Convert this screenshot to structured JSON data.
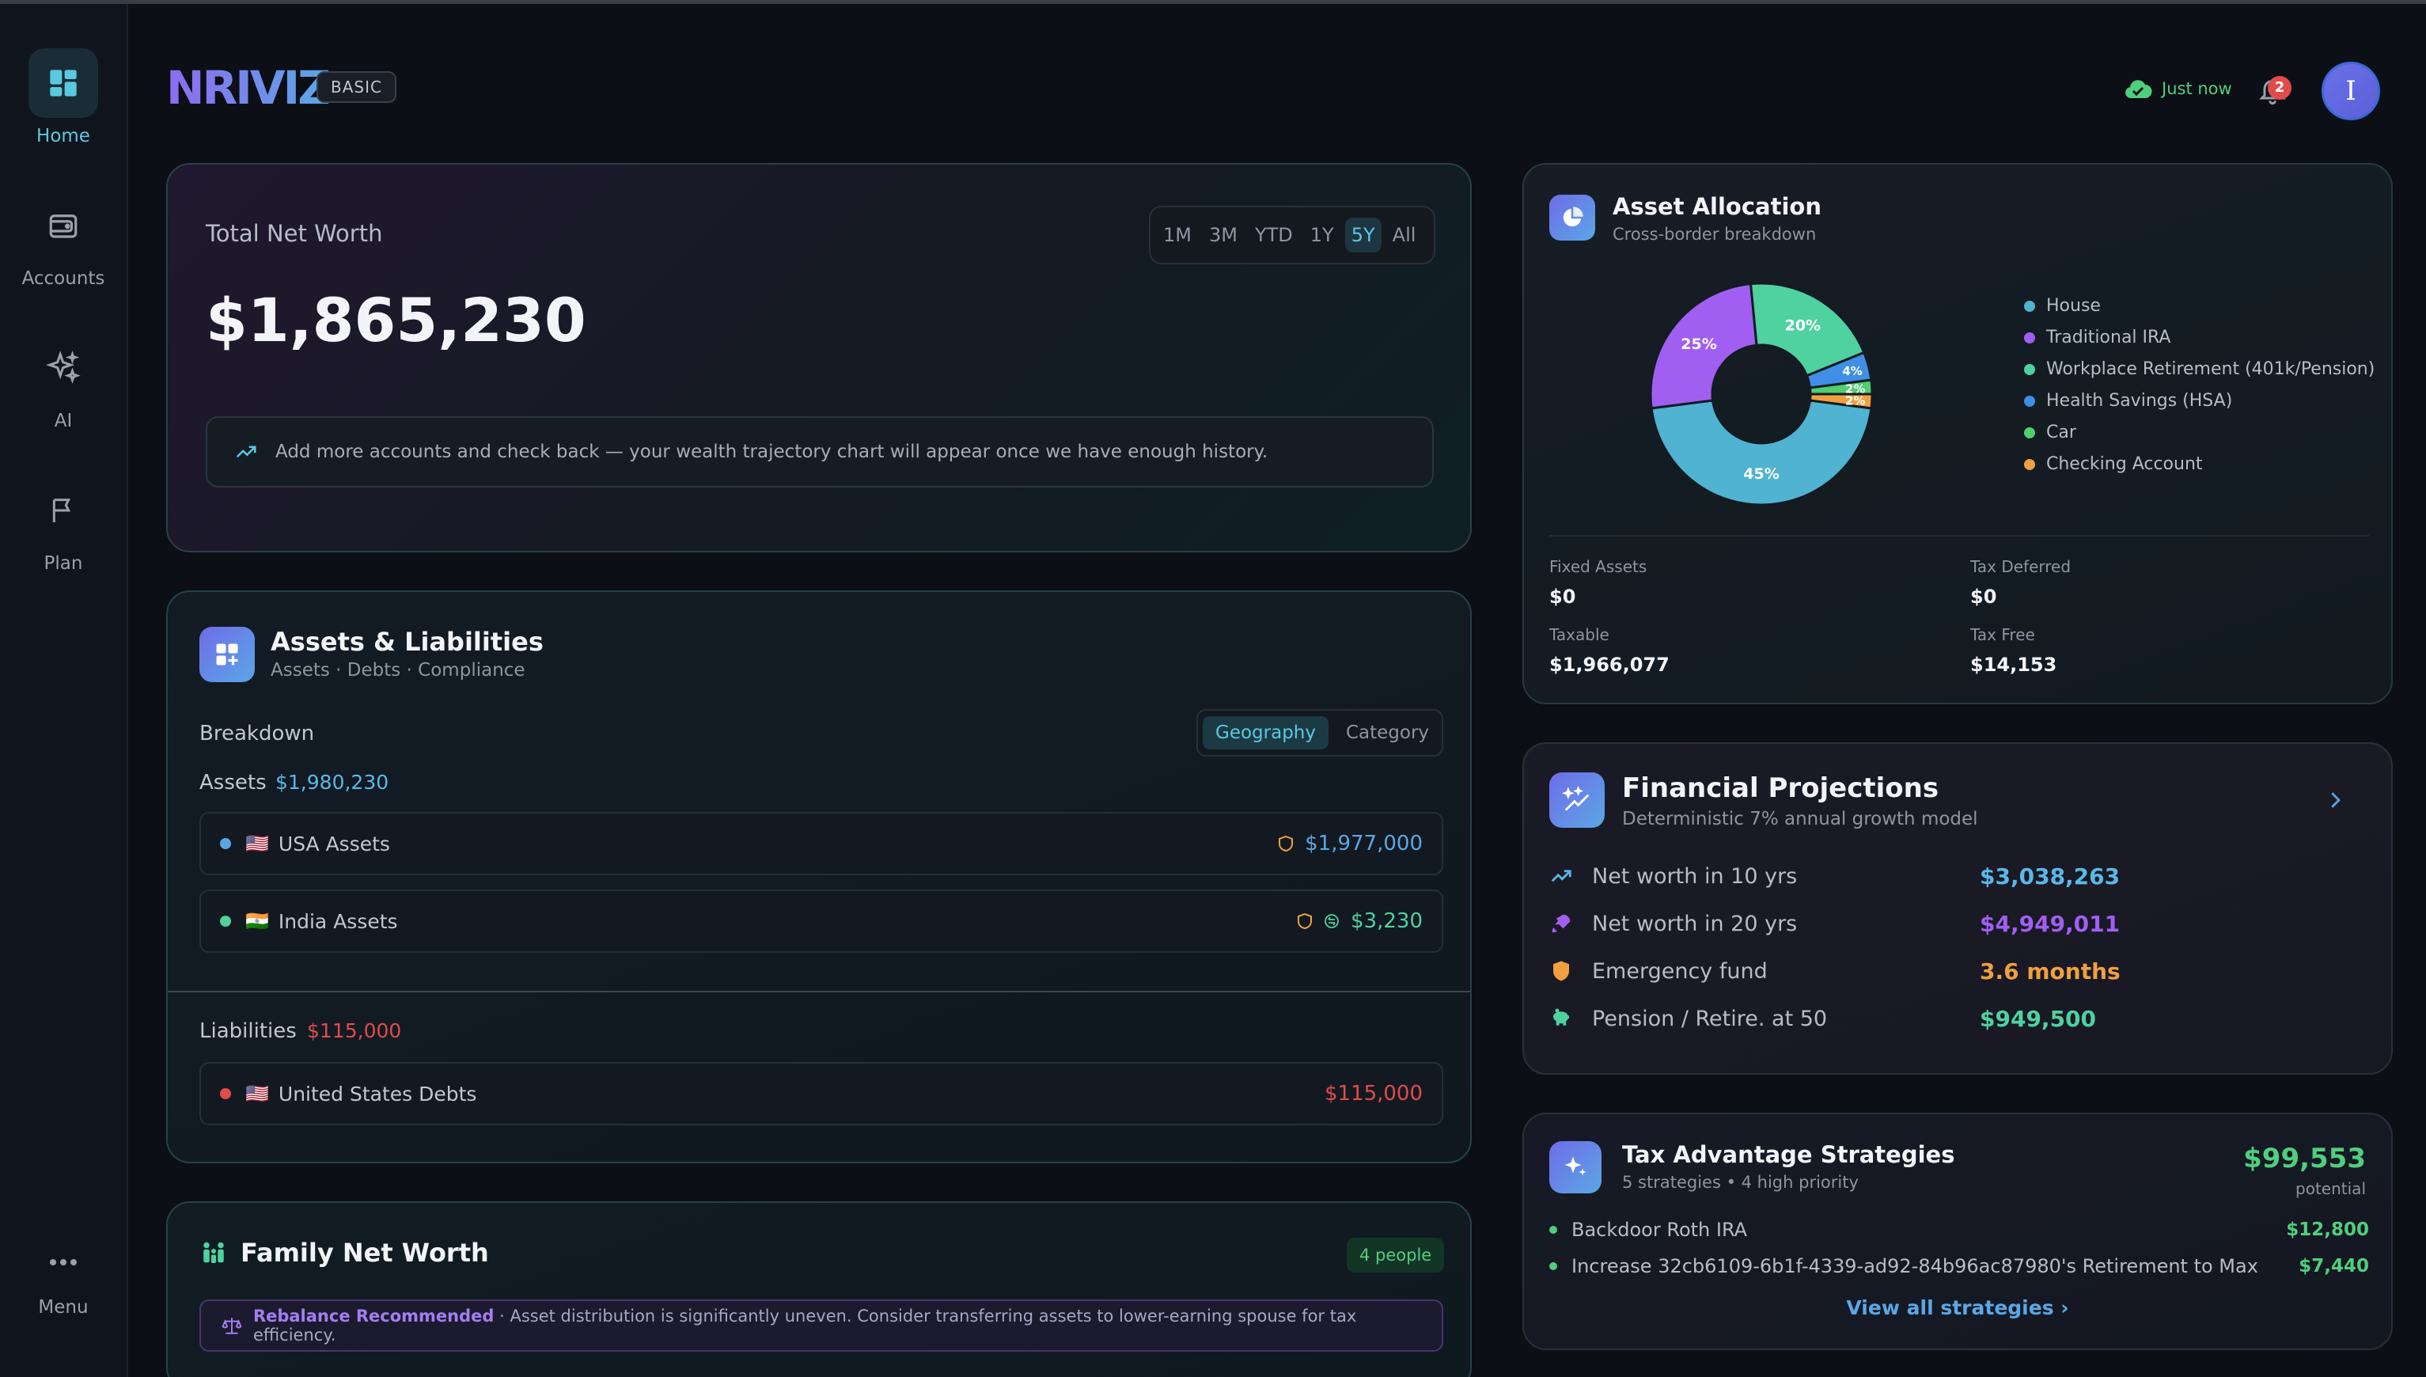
{
  "app": {
    "brand": "NRIVIZ",
    "plan": "BASIC"
  },
  "sidebar": {
    "items": [
      {
        "label": "Home",
        "icon": "dashboard-icon",
        "active": true
      },
      {
        "label": "Accounts",
        "icon": "wallet-icon"
      },
      {
        "label": "AI",
        "icon": "sparkles-icon"
      },
      {
        "label": "Plan",
        "icon": "flag-icon"
      }
    ],
    "menu_label": "Menu"
  },
  "header": {
    "sync_status": "Just now",
    "notification_count": "2",
    "avatar_initial": "I"
  },
  "net_worth": {
    "label": "Total Net Worth",
    "value": "$1,865,230",
    "ranges": [
      "1M",
      "3M",
      "YTD",
      "1Y",
      "5Y",
      "All"
    ],
    "active_range": "5Y",
    "note": "Add more accounts and check back — your wealth trajectory chart will appear once we have enough history."
  },
  "assets_liabilities": {
    "title": "Assets & Liabilities",
    "subtitle": "Assets · Debts · Compliance",
    "breakdown_label": "Breakdown",
    "toggle": [
      "Geography",
      "Category"
    ],
    "active_toggle": "Geography",
    "assets_label": "Assets",
    "assets_total": "$1,980,230",
    "asset_rows": [
      {
        "flag": "🇺🇸",
        "label": "USA Assets",
        "value": "$1,977,000",
        "color": "#5aa7e6"
      },
      {
        "flag": "🇮🇳",
        "label": "India Assets",
        "value": "$3,230",
        "color": "#4fd1a0"
      }
    ],
    "liabilities_label": "Liabilities",
    "liabilities_total": "$115,000",
    "liability_rows": [
      {
        "flag": "🇺🇸",
        "label": "United States Debts",
        "value": "$115,000",
        "color": "#e24b4b"
      }
    ]
  },
  "family": {
    "title": "Family Net Worth",
    "people": "4 people",
    "rebalance_title": "Rebalance Recommended",
    "rebalance_text": "· Asset distribution is significantly uneven. Consider transferring assets to lower-earning spouse for tax efficiency."
  },
  "allocation": {
    "title": "Asset Allocation",
    "subtitle": "Cross-border breakdown",
    "legend": [
      {
        "name": "House",
        "color": "#4fb3d1"
      },
      {
        "name": "Traditional IRA",
        "color": "#a05ff0"
      },
      {
        "name": "Workplace Retirement (401k/Pension)",
        "color": "#4fd1a0"
      },
      {
        "name": "Health Savings (HSA)",
        "color": "#3f8fe6"
      },
      {
        "name": "Car",
        "color": "#4fcf6e"
      },
      {
        "name": "Checking Account",
        "color": "#f0a040"
      }
    ],
    "metrics": [
      {
        "label": "Fixed Assets",
        "value": "$0"
      },
      {
        "label": "Tax Deferred",
        "value": "$0"
      },
      {
        "label": "Taxable",
        "value": "$1,966,077"
      },
      {
        "label": "Tax Free",
        "value": "$14,153"
      }
    ]
  },
  "chart_data": {
    "type": "pie",
    "donut": true,
    "labels": [
      "House",
      "Traditional IRA",
      "Workplace Retirement (401k/Pension)",
      "Health Savings (HSA)",
      "Car",
      "Checking Account"
    ],
    "values": [
      45,
      25,
      20,
      4,
      2,
      2
    ],
    "slice_labels": [
      "45%",
      "25%",
      "20%",
      "4%",
      "2%",
      "2%"
    ],
    "colors": [
      "#4fb3d1",
      "#a05ff0",
      "#4fd1a0",
      "#3f8fe6",
      "#4fcf6e",
      "#f0a040"
    ],
    "legend_position": "right"
  },
  "projections": {
    "title": "Financial Projections",
    "subtitle": "Deterministic 7% annual growth model",
    "rows": [
      {
        "label": "Net worth in 10 yrs",
        "value": "$3,038,263",
        "color": "#5ab8e6",
        "icon": "trend-up-icon"
      },
      {
        "label": "Net worth in 20 yrs",
        "value": "$4,949,011",
        "color": "#a05ff0",
        "icon": "rocket-icon"
      },
      {
        "label": "Emergency fund",
        "value": "3.6 months",
        "color": "#f0a040",
        "icon": "shield-icon"
      },
      {
        "label": "Pension / Retire. at 50",
        "value": "$949,500",
        "color": "#4fd1a0",
        "icon": "piggy-bank-icon"
      }
    ]
  },
  "tax": {
    "title": "Tax Advantage Strategies",
    "subtitle": "5 strategies • 4 high priority",
    "total": "$99,553",
    "total_label": "potential",
    "strategies": [
      {
        "name": "Backdoor Roth IRA",
        "value": "$12,800"
      },
      {
        "name": "Increase 32cb6109-6b1f-4339-ad92-84b96ac87980's Retirement to Max",
        "value": "$7,440"
      }
    ],
    "view_all": "View all strategies"
  }
}
